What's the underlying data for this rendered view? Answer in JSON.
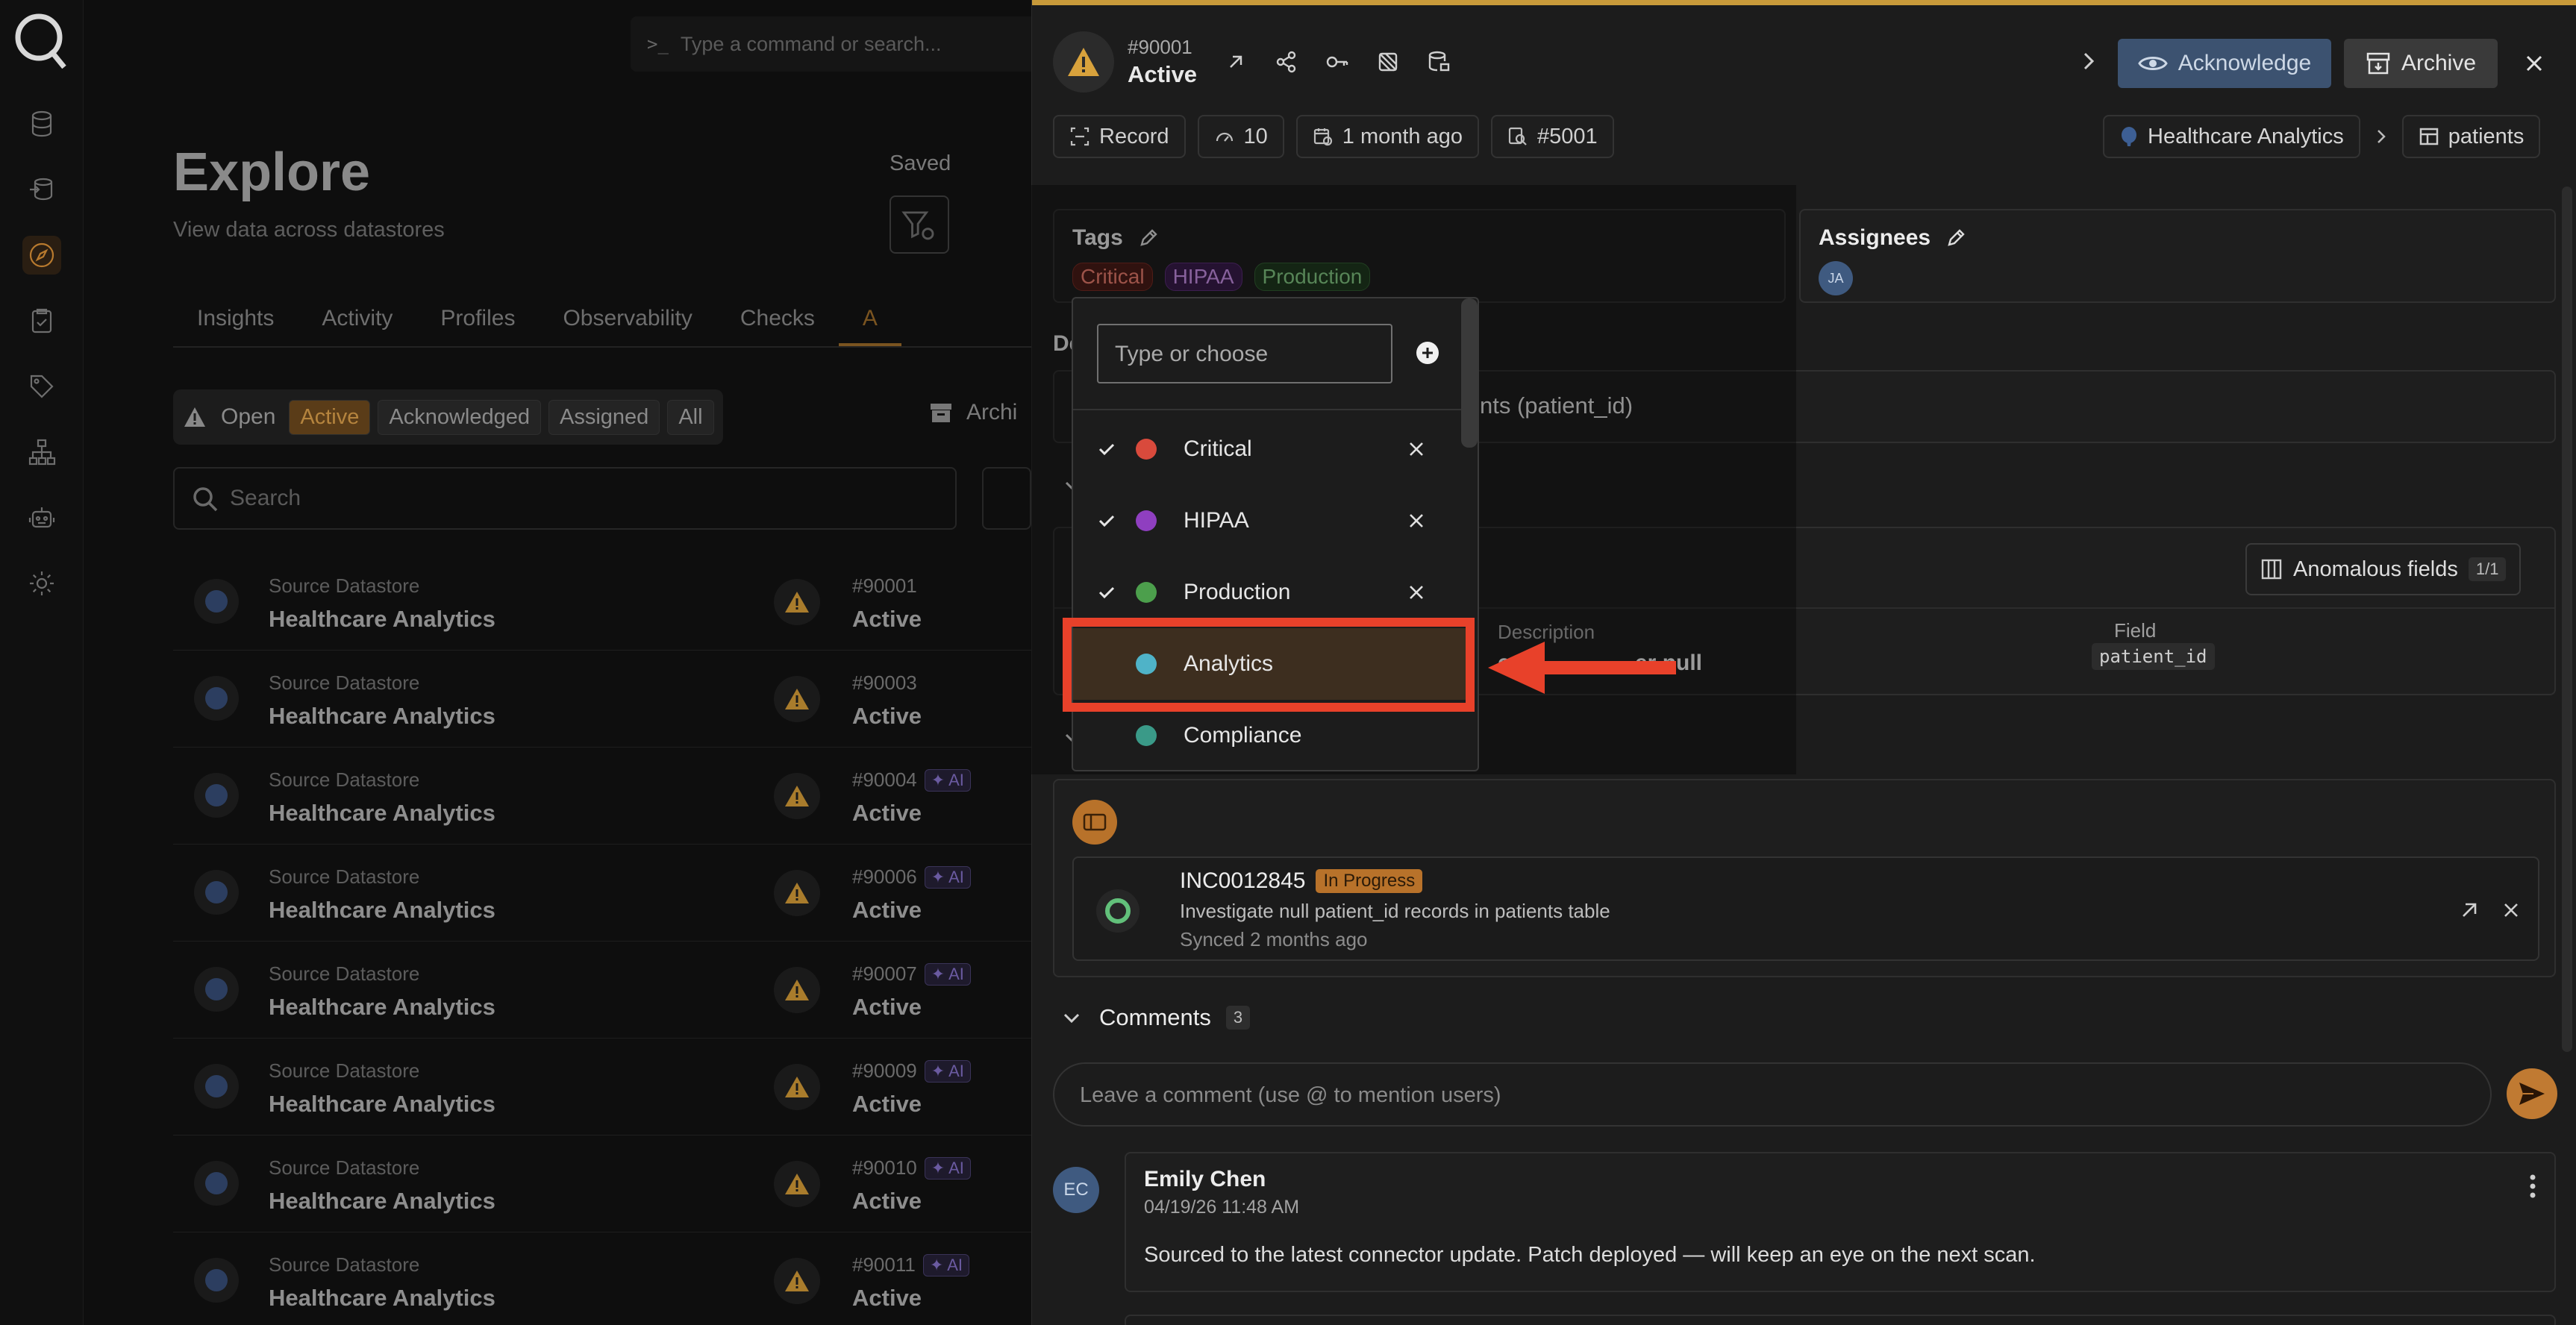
{
  "command_bar": {
    "placeholder": "Type a command or search..."
  },
  "explore": {
    "title": "Explore",
    "subtitle": "View data across datastores",
    "saved_label": "Saved",
    "tabs": [
      "Insights",
      "Activity",
      "Profiles",
      "Observability",
      "Checks",
      "A"
    ],
    "status_filter": {
      "group_label": "Open",
      "options": [
        "Active",
        "Acknowledged",
        "Assigned",
        "All"
      ],
      "selected": "Active"
    },
    "archived_label": "Archi",
    "search_placeholder": "Search",
    "rows": [
      {
        "source_label": "Source Datastore",
        "source_name": "Healthcare Analytics",
        "id": "#90001",
        "status": "Active",
        "ai": ""
      },
      {
        "source_label": "Source Datastore",
        "source_name": "Healthcare Analytics",
        "id": "#90003",
        "status": "Active",
        "ai": ""
      },
      {
        "source_label": "Source Datastore",
        "source_name": "Healthcare Analytics",
        "id": "#90004",
        "status": "Active",
        "ai": "AI"
      },
      {
        "source_label": "Source Datastore",
        "source_name": "Healthcare Analytics",
        "id": "#90006",
        "status": "Active",
        "ai": "AI"
      },
      {
        "source_label": "Source Datastore",
        "source_name": "Healthcare Analytics",
        "id": "#90007",
        "status": "Active",
        "ai": "AI"
      },
      {
        "source_label": "Source Datastore",
        "source_name": "Healthcare Analytics",
        "id": "#90009",
        "status": "Active",
        "ai": "AI"
      },
      {
        "source_label": "Source Datastore",
        "source_name": "Healthcare Analytics",
        "id": "#90010",
        "status": "Active",
        "ai": "AI"
      },
      {
        "source_label": "Source Datastore",
        "source_name": "Healthcare Analytics",
        "id": "#90011",
        "status": "Active",
        "ai": "AI"
      }
    ]
  },
  "panel": {
    "anomaly_id": "#90001",
    "status": "Active",
    "acknowledge_label": "Acknowledge",
    "archive_label": "Archive",
    "meta": {
      "type": "Record",
      "score": "10",
      "age": "1 month ago",
      "check": "#5001"
    },
    "breadcrumb": {
      "datastore": "Healthcare Analytics",
      "container": "patients"
    },
    "tags": {
      "heading": "Tags",
      "applied": [
        {
          "label": "Critical",
          "color": "#e05a4a"
        },
        {
          "label": "HIPAA",
          "color": "#a35ad0"
        },
        {
          "label": "Production",
          "color": "#5aa85a"
        }
      ]
    },
    "assignees": {
      "heading": "Assignees",
      "initials": "JA"
    },
    "description": {
      "heading": "De",
      "text_visible": "nts (patient_id)"
    },
    "anomalous_fields": {
      "button_label": "Anomalous fields",
      "count": "1/1",
      "description_label": "Description",
      "description_value": "es p",
      "description_value_tail": "er null",
      "field_label": "Field",
      "field_value": "patient_id"
    },
    "ticket": {
      "number": "INC0012845",
      "state": "In Progress",
      "summary": "Investigate null patient_id records in patients table",
      "synced": "Synced 2 months ago"
    },
    "comments": {
      "heading": "Comments",
      "count": "3",
      "placeholder": "Leave a comment (use @ to mention users)",
      "items": [
        {
          "initials": "EC",
          "author": "Emily Chen",
          "date": "04/19/26 11:48 AM",
          "text": "Sourced to the latest connector update. Patch deployed — will keep an eye on the next scan."
        }
      ]
    }
  },
  "tag_dropdown": {
    "placeholder": "Type or choose",
    "options": [
      {
        "label": "Critical",
        "color": "#d94a3c",
        "checked": true
      },
      {
        "label": "HIPAA",
        "color": "#8f3fc0",
        "checked": true
      },
      {
        "label": "Production",
        "color": "#4c9f4c",
        "checked": true
      },
      {
        "label": "Analytics",
        "color": "#4fb3c8",
        "checked": false,
        "highlighted": true
      },
      {
        "label": "Compliance",
        "color": "#3a9a88",
        "checked": false
      }
    ]
  },
  "colors": {
    "accent": "#c07a32",
    "highlight_box": "#e8412a",
    "ack_button": "#3c5270"
  }
}
